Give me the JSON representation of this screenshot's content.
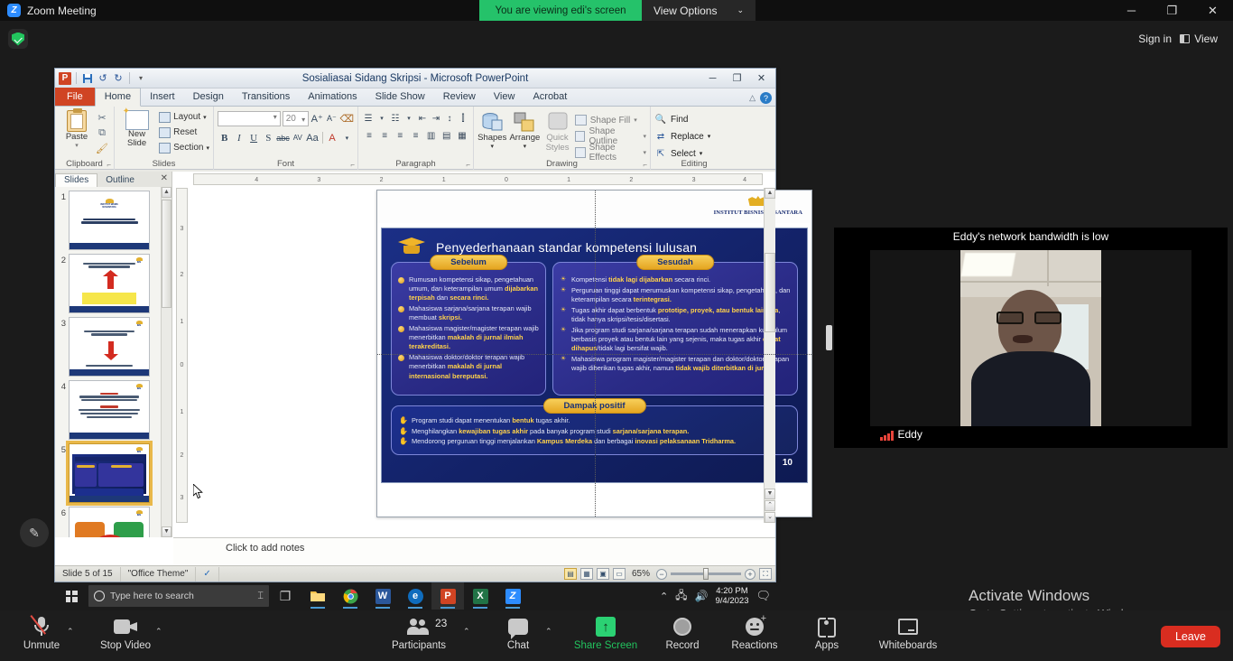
{
  "zoom_top": {
    "app_title": "Zoom Meeting",
    "logo_letter": "Z",
    "viewing_banner": "You are viewing edi's screen",
    "view_options": "View Options",
    "caret": "⌄",
    "minimize": "─",
    "maximize": "❐",
    "close": "✕",
    "sign_in": "Sign in",
    "view_button": "View"
  },
  "powerpoint": {
    "title": "Sosialiasai Sidang Skripsi  -  Microsoft PowerPoint",
    "app_letter": "P",
    "qat": [
      "save-icon",
      "undo-icon",
      "redo-icon",
      "customize-icon"
    ],
    "window_buttons": {
      "minimize": "─",
      "restore": "❐",
      "close": "✕"
    },
    "tabs": [
      "File",
      "Home",
      "Insert",
      "Design",
      "Transitions",
      "Animations",
      "Slide Show",
      "Review",
      "View",
      "Acrobat"
    ],
    "active_tab": "Home",
    "help_label": "?",
    "ribbon": {
      "groups": [
        {
          "name": "Clipboard",
          "paste_label": "Paste",
          "items": [
            "Cut",
            "Copy",
            "Format Painter"
          ]
        },
        {
          "name": "Slides",
          "new_slide_label": "New\nSlide",
          "new_slide_line1": "New",
          "new_slide_line2": "Slide",
          "items": [
            "Layout",
            "Reset",
            "Section"
          ]
        },
        {
          "name": "Font",
          "font_name": "",
          "font_size": "20",
          "buttons": [
            "B",
            "I",
            "U",
            "S",
            "abc",
            "AV",
            "Aa",
            "A"
          ]
        },
        {
          "name": "Paragraph"
        },
        {
          "name": "Drawing",
          "shapes_label": "Shapes",
          "arrange_label": "Arrange",
          "quick_styles_l1": "Quick",
          "quick_styles_l2": "Styles",
          "items": [
            "Shape Fill",
            "Shape Outline",
            "Shape Effects"
          ]
        },
        {
          "name": "Editing",
          "items": [
            "Find",
            "Replace",
            "Select"
          ]
        }
      ]
    },
    "slides_pane": {
      "tabs": [
        "Slides",
        "Outline"
      ],
      "active": "Slides",
      "close": "✕",
      "thumbnails": [
        {
          "num": "1",
          "kind": "title"
        },
        {
          "num": "2",
          "kind": "arrow-yellow"
        },
        {
          "num": "3",
          "kind": "arrow-red"
        },
        {
          "num": "4",
          "kind": "text"
        },
        {
          "num": "5",
          "kind": "current",
          "selected": true
        },
        {
          "num": "6",
          "kind": "diagram"
        }
      ]
    },
    "ruler": {
      "h_ticks": [
        "4",
        "3",
        "2",
        "1",
        "0",
        "1",
        "2",
        "3",
        "4"
      ],
      "v_ticks": [
        "3",
        "2",
        "1",
        "0",
        "1",
        "2",
        "3"
      ]
    },
    "notes_placeholder": "Click to add notes",
    "status": {
      "slide_counter": "Slide 5 of 15",
      "theme": "\"Office Theme\"",
      "spell_icon": "spellcheck-icon",
      "zoom_level": "65%",
      "zoom_out": "−",
      "zoom_in": "+",
      "fit_icon": "fit-slide-icon",
      "view_buttons": [
        "normal-view",
        "slide-sorter-view",
        "reading-view",
        "slide-show-view"
      ]
    },
    "slide": {
      "brand": "INSTITUT BISNIS NUSANTARA",
      "title": "Penyederhanaan standar kompetensi lulusan",
      "page_number": "10",
      "before": {
        "heading": "Sebelum",
        "bullets": [
          [
            {
              "t": "Rumusan kompetensi sikap, pengetahuan umum, dan keterampilan umum "
            },
            {
              "t": "dijabarkan terpisah",
              "hl": true
            },
            {
              "t": " dan "
            },
            {
              "t": "secara rinci.",
              "hl": true
            }
          ],
          [
            {
              "t": "Mahasiswa sarjana/sarjana terapan wajib membuat "
            },
            {
              "t": "skripsi.",
              "hl": true
            }
          ],
          [
            {
              "t": "Mahasiswa magister/magister terapan wajib menerbitkan "
            },
            {
              "t": "makalah di jurnal ilmiah terakreditasi.",
              "hl": true
            }
          ],
          [
            {
              "t": "Mahasiswa doktor/doktor terapan wajib menerbitkan "
            },
            {
              "t": "makalah di jurnal internasional bereputasi.",
              "hl": true
            }
          ]
        ]
      },
      "after": {
        "heading": "Sesudah",
        "bullets": [
          [
            {
              "t": "Kompetensi "
            },
            {
              "t": "tidak lagi dijabarkan",
              "hl": true
            },
            {
              "t": " secara rinci."
            }
          ],
          [
            {
              "t": "Perguruan tinggi dapat merumuskan kompetensi sikap, pengetahuan, dan keterampilan secara "
            },
            {
              "t": "terintegrasi.",
              "hl": true
            }
          ],
          [
            {
              "t": "Tugas akhir dapat berbentuk "
            },
            {
              "t": "prototipe, proyek, atau bentuk lainnya",
              "hl": true
            },
            {
              "t": ", tidak hanya skripsi/tesis/disertasi."
            }
          ],
          [
            {
              "t": "Jika program studi sarjana/sarjana terapan sudah menerapkan kurikulum berbasis proyek atau bentuk lain yang sejenis, maka tugas akhir "
            },
            {
              "t": "dapat dihapus",
              "hl": true
            },
            {
              "t": "/tidak lagi bersifat wajib."
            }
          ],
          [
            {
              "t": "Mahasiswa program magister/magister terapan dan doktor/doktor terapan wajib diberikan tugas akhir, namun "
            },
            {
              "t": "tidak wajib diterbitkan di jurnal.",
              "hl": true
            }
          ]
        ]
      },
      "impact": {
        "heading": "Dampak positif",
        "bullets": [
          [
            {
              "t": "Program studi dapat menentukan "
            },
            {
              "t": "bentuk",
              "hl": true
            },
            {
              "t": " tugas akhir."
            }
          ],
          [
            {
              "t": "Menghilangkan "
            },
            {
              "t": "kewajiban tugas akhir",
              "hl": true
            },
            {
              "t": " pada banyak program studi "
            },
            {
              "t": "sarjana/sarjana terapan.",
              "hl": true
            }
          ],
          [
            {
              "t": "Mendorong perguruan tinggi menjalankan "
            },
            {
              "t": "Kampus Merdeka",
              "hl": true
            },
            {
              "t": " dan berbagai "
            },
            {
              "t": "inovasi pelaksanaan Tridharma.",
              "hl": true
            }
          ]
        ]
      }
    }
  },
  "taskbar": {
    "search_placeholder": "Type here to search",
    "icons": [
      {
        "name": "task-view-icon",
        "glyph": "▣",
        "color": "#c9c9c9",
        "bg": "transparent"
      },
      {
        "name": "file-explorer-icon",
        "glyph": "",
        "color": "#fff",
        "bg": "#f6c049"
      },
      {
        "name": "chrome-icon",
        "glyph": "",
        "color": "#fff",
        "bg": "#3ca44a"
      },
      {
        "name": "word-icon",
        "glyph": "W",
        "color": "#fff",
        "bg": "#2b579a"
      },
      {
        "name": "edge-icon",
        "glyph": "e",
        "color": "#fff",
        "bg": "#0f6cbd"
      },
      {
        "name": "powerpoint-icon",
        "glyph": "P",
        "color": "#fff",
        "bg": "#d04423"
      },
      {
        "name": "excel-icon",
        "glyph": "X",
        "color": "#fff",
        "bg": "#217346"
      },
      {
        "name": "zoom-icon",
        "glyph": "Z",
        "color": "#fff",
        "bg": "#2d8cff"
      }
    ],
    "tray": {
      "chevron": "⌃",
      "network": "network-icon",
      "volume": "volume-icon"
    },
    "clock_time": "4:20 PM",
    "clock_date": "9/4/2023",
    "notification": "notification-icon"
  },
  "video": {
    "bandwidth_notice": "Eddy's network bandwidth is low",
    "participant_name": "Eddy",
    "signal_icon": "signal-bars-icon"
  },
  "watermark": {
    "line1": "Activate Windows",
    "line2": "Go to Settings to activate Windows."
  },
  "zoom_bottom": {
    "items": [
      {
        "name": "unmute",
        "label": "Unmute",
        "caret": "⌃"
      },
      {
        "name": "stop-video",
        "label": "Stop Video",
        "caret": "⌃"
      },
      {
        "name": "participants",
        "label": "Participants",
        "count": "23",
        "caret": "⌃"
      },
      {
        "name": "chat",
        "label": "Chat",
        "caret": "⌃"
      },
      {
        "name": "share-screen",
        "label": "Share Screen"
      },
      {
        "name": "record",
        "label": "Record"
      },
      {
        "name": "reactions",
        "label": "Reactions"
      },
      {
        "name": "apps",
        "label": "Apps"
      },
      {
        "name": "whiteboards",
        "label": "Whiteboards"
      }
    ],
    "leave_label": "Leave",
    "share_active_color": "#22c35e"
  },
  "annotation": {
    "pencil_icon": "pencil-icon"
  }
}
